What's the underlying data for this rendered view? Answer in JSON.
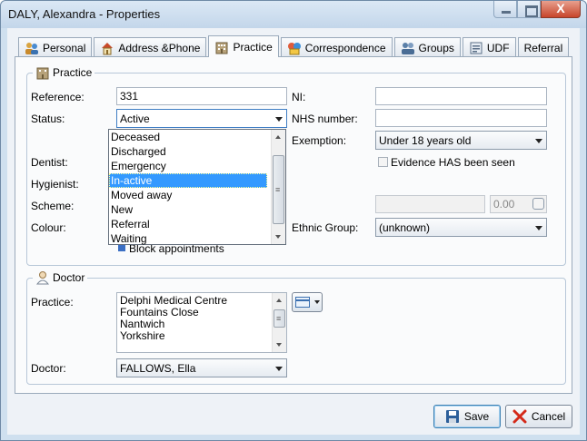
{
  "window": {
    "title": "DALY, Alexandra - Properties",
    "close_label": "X"
  },
  "tabs": [
    {
      "label": "Personal",
      "icon": "people-icon"
    },
    {
      "label": "Address &Phone",
      "icon": "house-icon"
    },
    {
      "label": "Practice",
      "icon": "building-icon",
      "active": true
    },
    {
      "label": "Correspondence",
      "icon": "letters-icon"
    },
    {
      "label": "Groups",
      "icon": "group-icon"
    },
    {
      "label": "UDF",
      "icon": "form-icon"
    },
    {
      "label": "Referral",
      "icon": ""
    }
  ],
  "practice_group": {
    "title": "Practice",
    "reference_label": "Reference:",
    "reference_value": "331",
    "status_label": "Status:",
    "status_value": "Active",
    "dentist_label": "Dentist:",
    "hygienist_label": "Hygienist:",
    "scheme_label": "Scheme:",
    "colour_label": "Colour:",
    "ni_label": "NI:",
    "ni_value": "",
    "nhs_label": "NHS number:",
    "nhs_value": "",
    "exemption_label": "Exemption:",
    "exemption_value": "Under 18 years old",
    "evidence_label": "Evidence HAS been seen",
    "amount_value": "0.00",
    "ethnic_label": "Ethnic Group:",
    "ethnic_value": "(unknown)",
    "block_label": "Block appointments"
  },
  "status_dropdown": {
    "options": [
      "Deceased",
      "Discharged",
      "Emergency",
      "In-active",
      "Moved away",
      "New",
      "Referral",
      "Waiting"
    ],
    "highlighted": "In-active"
  },
  "doctor_group": {
    "title": "Doctor",
    "practice_label": "Practice:",
    "practice_lines": [
      "Delphi Medical Centre",
      "Fountains Close",
      "Nantwich",
      "Yorkshire"
    ],
    "doctor_label": "Doctor:",
    "doctor_value": "FALLOWS, Ella"
  },
  "buttons": {
    "save": "Save",
    "cancel": "Cancel"
  }
}
